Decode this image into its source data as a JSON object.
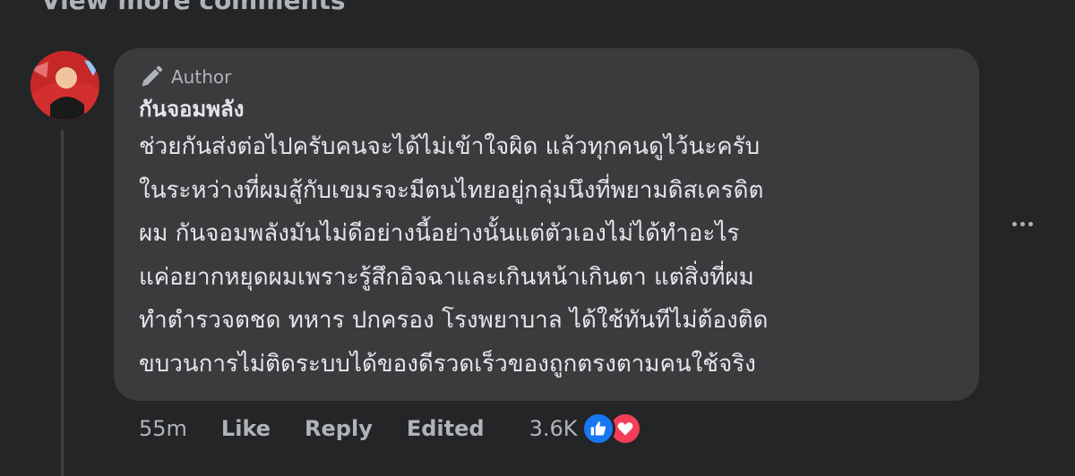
{
  "header": {
    "view_more": "View more comments"
  },
  "comment": {
    "badge": "Author",
    "author_name": "กันจอมพลัง",
    "text_lines": [
      "ช่วยกันส่งต่อไปครับคนจะได้ไม่เข้าใจผิด แล้วทุกคนดูไว้นะครับ",
      "ในระหว่างที่ผมสู้กับเขมรจะมีตนไทยอยู่กลุ่มนึงที่พยามดิสเครดิต",
      "ผม กันจอมพลังมันไม่ดีอย่างนี้อย่างนั้นแต่ตัวเองไม่ได้ทำอะไร",
      "แค่อยากหยุดผมเพราะรู้สึกอิจฉาและเกินหน้าเกินตา แต่สิ่งที่ผม",
      "ทำตำรวจตชด ทหาร ปกครอง โรงพยาบาล ได้ใช้ทันทีไม่ต้องติด",
      "ขบวนการไม่ติดระบบได้ของดีรวดเร็วของถูกตรงตามคนใช้จริง"
    ]
  },
  "actions": {
    "time": "55m",
    "like": "Like",
    "reply": "Reply",
    "edited": "Edited",
    "reaction_count": "3.6K"
  },
  "icons": {
    "badge": "pencil-icon",
    "more": "more-options-icon",
    "reactions": [
      "like-reaction-icon",
      "love-reaction-icon"
    ]
  },
  "colors": {
    "background": "#242526",
    "bubble": "#3a3b3c",
    "text_primary": "#e4e6eb",
    "text_secondary": "#b0b3b8",
    "like_blue": "#1877f2",
    "love_red": "#f33e58"
  }
}
